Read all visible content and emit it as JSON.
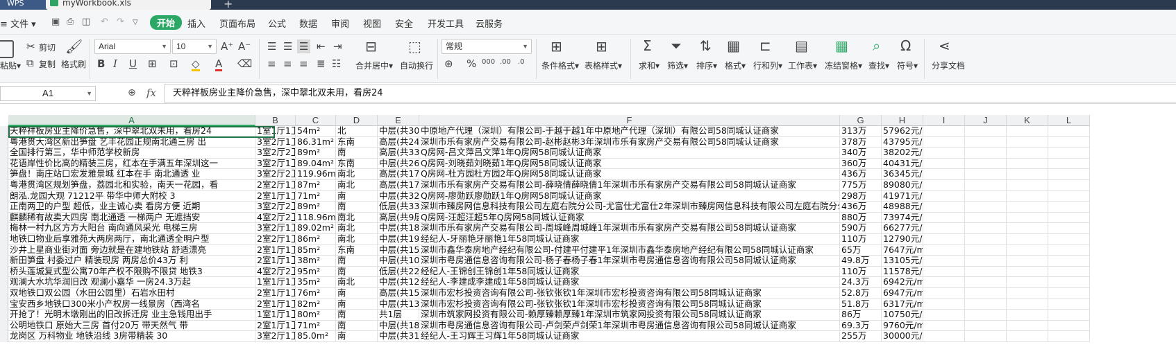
{
  "titlebar": {
    "app_tab": "WPS",
    "doc_tab": "myWorkbook.xls",
    "new_tab": "+"
  },
  "menu": {
    "file": "≡ 文件 ▾",
    "tabs": [
      "开始",
      "插入",
      "页面布局",
      "公式",
      "数据",
      "审阅",
      "视图",
      "安全",
      "开发工具",
      "云服务"
    ]
  },
  "ribbon": {
    "paste": "粘贴▾",
    "cut": "剪切",
    "copy": "复制",
    "format_painter": "格式刷",
    "font_name": "Arial",
    "font_size": "10",
    "merge": "合并居中▾",
    "wrap": "自动换行",
    "number_format": "常规",
    "conditional": "条件格式▾",
    "table_style": "表格样式▾",
    "sum": "求和▾",
    "filter": "筛选▾",
    "sort": "排序▾",
    "format": "格式▾",
    "rowcol": "行和列▾",
    "worksheet": "工作表▾",
    "freeze": "冻结窗格▾",
    "find": "查找▾",
    "symbol": "符号▾",
    "share": "分享文档"
  },
  "formula_bar": {
    "name_box": "A1",
    "fx": "fx",
    "content": "天粹祥板房业主降价急售，深中翠北双未用，看房24"
  },
  "columns": [
    "A",
    "B",
    "C",
    "D",
    "E",
    "F",
    "G",
    "H",
    "I",
    "J",
    "K",
    "L"
  ],
  "rows": [
    [
      "天粹祥板房业主降价急售，深中翠北双未用，看房24",
      "1室1厅1卫",
      "54m²",
      "北",
      "中层(共30层",
      "中原地产代理（深圳）有限公司-于越于越1年中原地产代理（深圳）有限公司58同城认证商家",
      "313万",
      "57962元/m²"
    ],
    [
      "粤港贯大湾区新出笋盘 艺丰花园正规南北通三房 出",
      "3室2厅1卫",
      "86.31m²",
      "东南",
      "高层(共24层",
      "深圳市乐有家房产交易有限公司-赵彬赵彬3年深圳市乐有家房产交易有限公司58同城认证商家",
      "378万",
      "43795元/m²"
    ],
    [
      "全国排行第三，华中师范学校新房",
      "3室2厅2卫",
      "89m²",
      "南",
      "高层(共33层",
      "Q房网-吕文萍吕文萍1年Q房网58同城认证商家",
      "340万",
      "38202元/m²"
    ],
    [
      "花语岸性价比高的精装三房，红本在手满五年深圳这一",
      "3室2厅1卫",
      "89.04m²",
      "东南",
      "中层(共26层",
      "Q房网-刘晓茹刘晓茹1年Q房网58同城认证商家",
      "360万",
      "40431元/m²"
    ],
    [
      "笋盘！南庄站口宏发雅景城 红本在手 南北通透 业",
      "3室2厅2卫",
      "119.96m²",
      "南北",
      "高层(共17层",
      "Q房网-杜方园杜方园2年Q房网58同城认证商家",
      "436万",
      "36345元/m²"
    ],
    [
      "粤港贯湾区规划笋盘，荔园北和实验，南天一花园，看",
      "2室2厅1卫",
      "87m²",
      "南北",
      "高层(共17层",
      "深圳市乐有家房产交易有限公司-薛晓倩薛晓倩1年深圳市乐有家房产交易有限公司58同城认证商家",
      "775万",
      "89080元/m²"
    ],
    [
      "朗泓.龙园大观 71212平 带华中师大附校 3",
      "2室1厅1卫",
      "71m²",
      "南",
      "中层(共32层",
      "Q房网-廖勋跃廖勋跃1年Q房网58同城认证商家",
      "298万",
      "41971元/m²"
    ],
    [
      "正南两卫的户型 超低，业主诚心卖 看房方便 近期",
      "3室2厅2卫",
      "89m²",
      "南",
      "低层(共33层",
      "深圳市臻房网信息科技有限公司左庭右院分公司-尤富仕尤富仕2年深圳市臻房网信息科技有限公司左庭右院分公司58同城认证商家",
      "436万",
      "48988元/m²"
    ],
    [
      "麒麟稀有故卖大四房 南北通透 一梯两户 无遮挡安",
      "4室2厅2卫",
      "118.96m²",
      "南北",
      "高层(共9层)",
      "Q房网-汪超汪超5年Q房网58同城认证商家",
      "880万",
      "73974元/m²"
    ],
    [
      "梅林一村九区方方大阳台 南向通风采光 电梯三房",
      "3室2厅1卫",
      "89.02m²",
      "南北",
      "中层(共18层",
      "深圳市乐有家房产交易有限公司-周城峰周城峰1年深圳市乐有家房产交易有限公司58同城认证商家",
      "590万",
      "66277元/m²"
    ],
    [
      "地铁口物业后享雅苑大两房两厅，南北通透全明户型",
      "2室2厅1卫",
      "86m²",
      "南北",
      "中层(共19层",
      "经纪人-牙丽艳牙丽艳1年58同城认证商家",
      "110万",
      "12790元/m²"
    ],
    [
      "沙井上星商业街对面 旁边就是在建地铁站 舒适漂亮",
      "2室1厅1卫",
      "85m²",
      "东南",
      "中层(共15层",
      "深圳市鑫华泰房地产经纪有限公司-付建平付建平1年深圳市鑫华泰房地产经纪有限公司58同城认证商家",
      "65万",
      "7647元/m²"
    ],
    [
      "新田笋盘 村委过户 精装现房 两房总价43万 利",
      "2室1厅1卫",
      "38m²",
      "南",
      "中层(共10层",
      "深圳市粤房通信息咨询有限公司-杨子春杨子春1年深圳市粤房通信息咨询有限公司58同城认证商家",
      "49.8万",
      "13105元/m²"
    ],
    [
      "桥头莲城复式型公寓70年产权不限购不限贷 地铁3",
      "4室2厅2卫",
      "95m²",
      "南",
      "低层(共22层",
      "经纪人-王锦创王锦创1年58同城认证商家",
      "110万",
      "11578元/m²"
    ],
    [
      "观澜大水坑华润旧改 观澜小嘉华 一房24.3万起",
      "1室1厅1卫",
      "35m²",
      "南北",
      "中层(共12层",
      "经纪人-李建成李建成1年58同城认证商家",
      "24.3万",
      "6942元/m²"
    ],
    [
      "双地铁口双公园（水田公园里）石岩水田村",
      "2室1厅1卫",
      "76m²",
      "南",
      "高层(共15层",
      "深圳市宏杉投资咨询有限公司-张钦张钦1年深圳市宏杉投资咨询有限公司58同城认证商家",
      "52.8万",
      "6947元/m²"
    ],
    [
      "宝安西乡地铁口300米小产权房一线景房（西湾名",
      "2室1厅1卫",
      "82m²",
      "南",
      "中层(共13层",
      "深圳市宏杉投资咨询有限公司-张钦张钦1年深圳市宏杉投资咨询有限公司58同城认证商家",
      "51.8万",
      "6317元/m²"
    ],
    [
      "开抢了！光明木墩刚出的旧改拆迁房 业主急钱甩出手",
      "1室1厅1卫",
      "80m²",
      "南",
      "共1层",
      "深圳市筑家网投资有限公司-赖厚臻赖厚臻1年深圳市筑家网投资有限公司58同城认证商家",
      "86万",
      "10750元/m²"
    ],
    [
      "公明地铁口 原始大三房 首付20万 带天然气 带",
      "2室1厅1卫",
      "71m²",
      "南",
      "中层(共18层",
      "深圳市粤房通信息咨询有限公司-卢剑荣卢剑荣1年深圳市粤房通信息咨询有限公司58同城认证商家",
      "69.3万",
      "9760元/m²"
    ],
    [
      "龙岗区 万科物业 地铁沿线 3房带精装 30",
      "3室2厅1卫",
      "85.0m²",
      "南",
      "中层(共31层",
      "经纪人-王习辉王习辉1年58同城认证商家",
      "255万",
      "30000元/m²"
    ]
  ]
}
